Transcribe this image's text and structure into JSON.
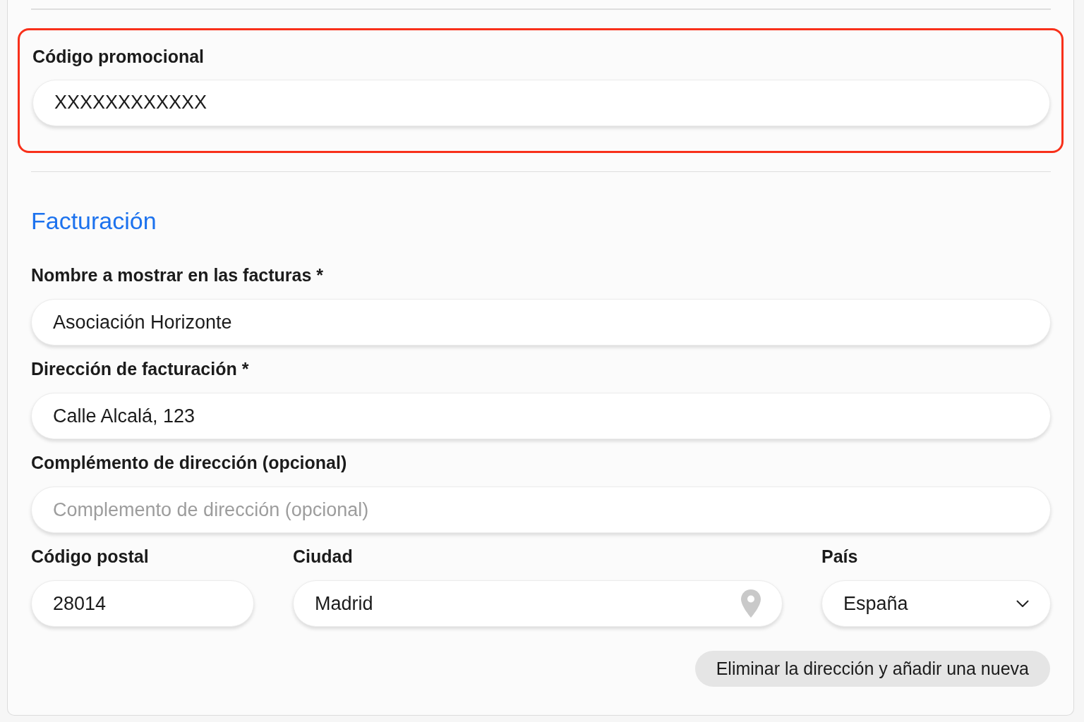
{
  "promo_code": {
    "label": "Código promocional",
    "value": "XXXXXXXXXXXX",
    "highlighted": true
  },
  "billing": {
    "heading": "Facturación",
    "fields": [
      {
        "kind": "text",
        "label": "Nombre a mostrar en las facturas *",
        "value": "Asociación Horizonte"
      },
      {
        "kind": "text",
        "label": "Dirección de facturación *",
        "value": "Calle Alcalá, 123"
      },
      {
        "kind": "text",
        "label": "Complémento de dirección (opcional)",
        "placeholder": "Complemento de dirección (opcional)"
      }
    ],
    "address_row": [
      {
        "kind": "text",
        "label": "Código postal",
        "value": "28014"
      },
      {
        "kind": "location",
        "label": "Ciudad",
        "value": "Madrid"
      },
      {
        "kind": "select",
        "label": "País",
        "value": "España"
      }
    ],
    "button": "Eliminar la dirección y añadir una nueva"
  }
}
